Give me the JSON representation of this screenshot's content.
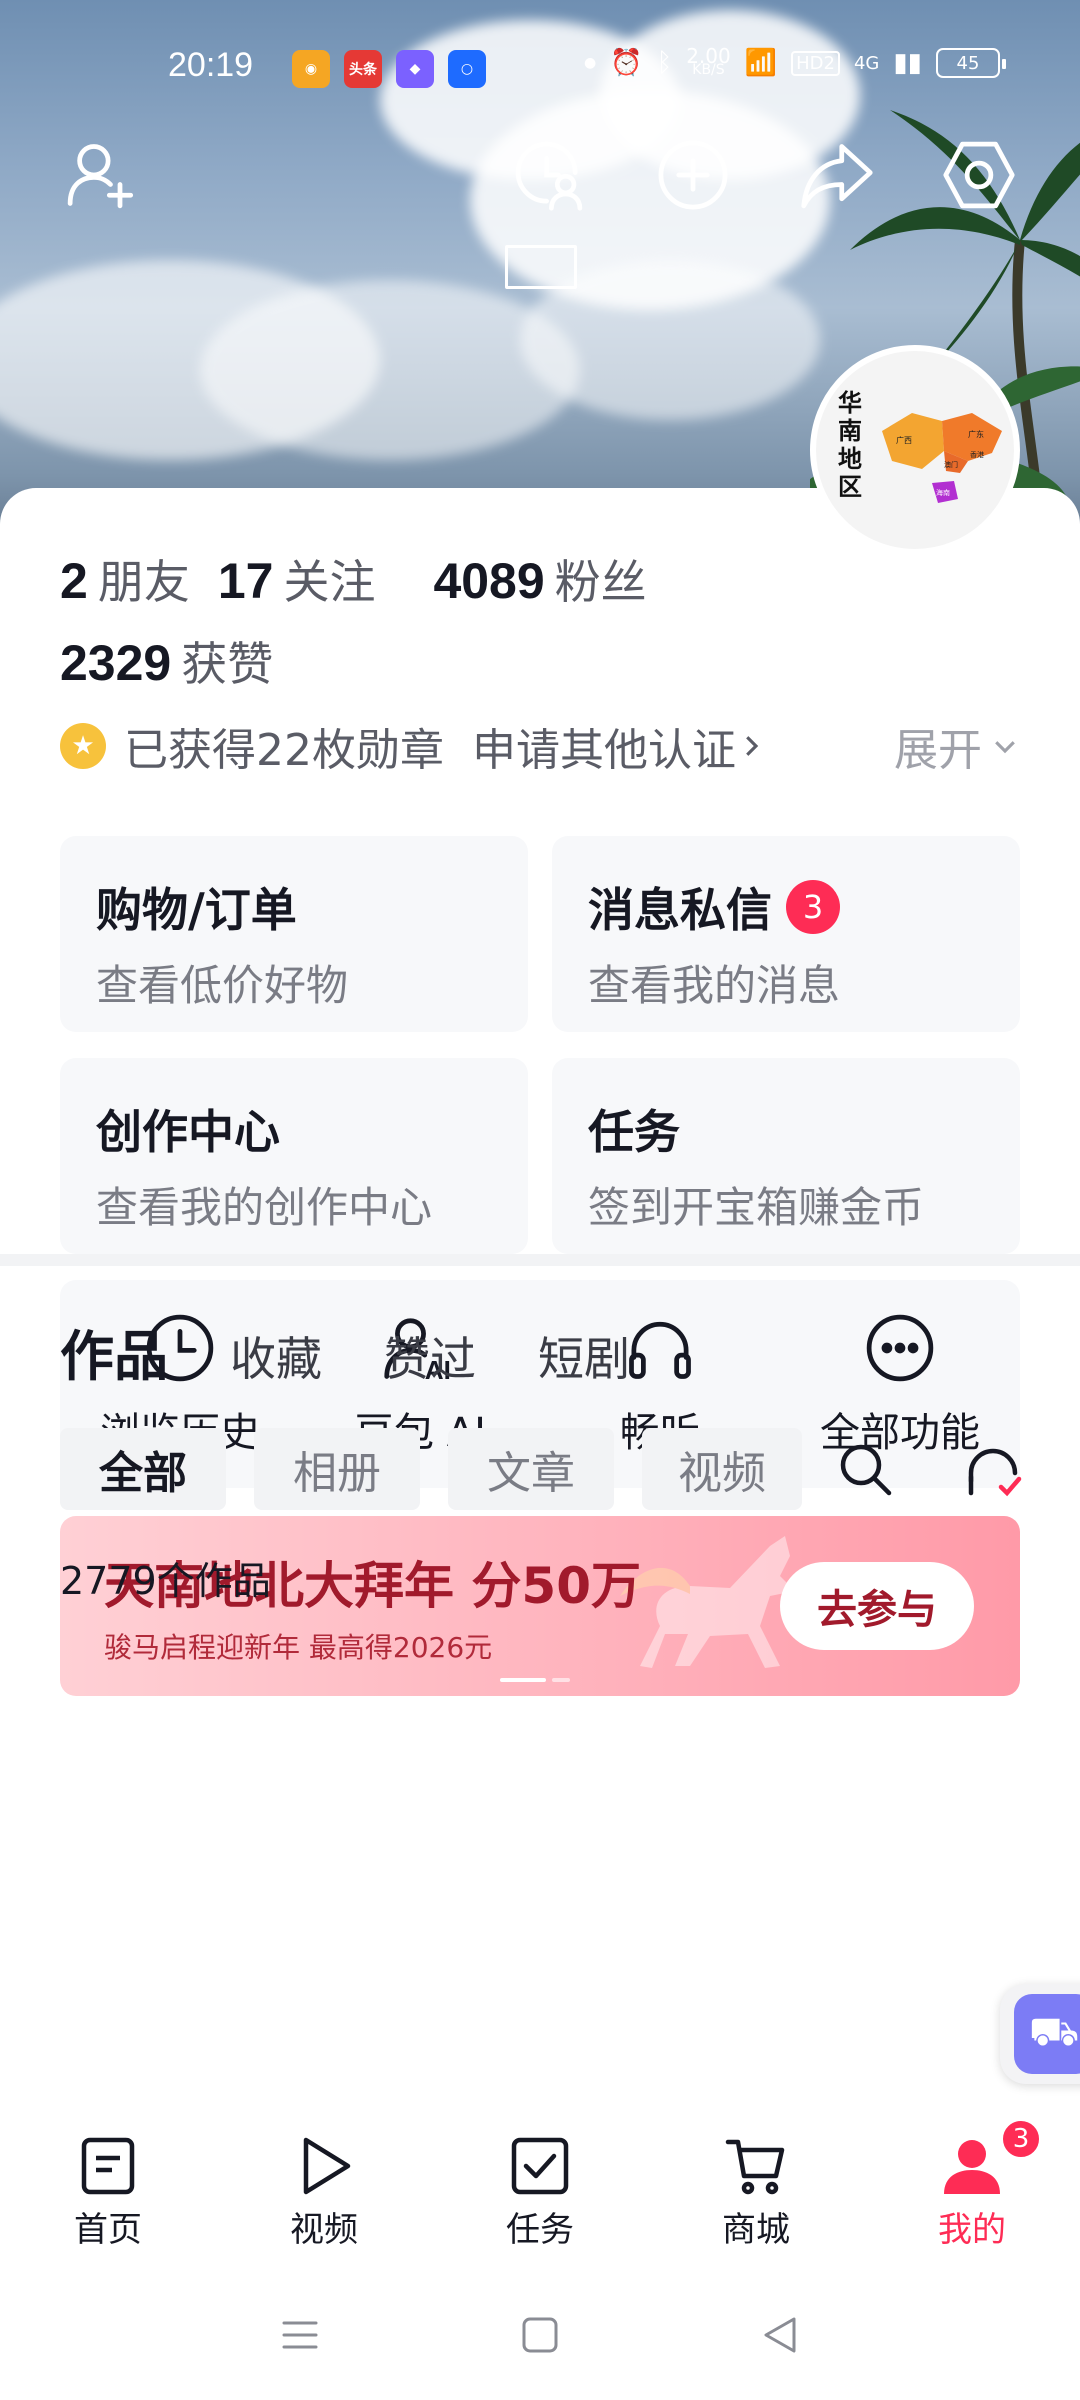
{
  "status_bar": {
    "time": "20:19",
    "apps": [
      {
        "icon": "weibo-app-icon",
        "label": "",
        "color": "#f5a623"
      },
      {
        "icon": "toutiao-app-icon",
        "label": "头条",
        "color": "#e53935"
      },
      {
        "icon": "shortcut-app-icon",
        "label": "",
        "color": "#7b61ff"
      },
      {
        "icon": "qq-browser-app-icon",
        "label": "",
        "color": "#1e6bff"
      }
    ],
    "net_speed_value": "2.00",
    "net_speed_unit": "KB/S",
    "hd": "HD2",
    "signal": "4G",
    "battery": "45"
  },
  "header_buttons": {
    "add_friend": "add-friend-icon",
    "visitors": "visitor-history-icon",
    "create": "plus-circle-icon",
    "share": "share-icon",
    "settings": "settings-hexagon-icon"
  },
  "avatar": {
    "title": "华南地区",
    "map_labels": [
      "广西",
      "广东",
      "澳门",
      "香港",
      "海南"
    ]
  },
  "stats": {
    "friends_count": "2",
    "friends_label": "朋友",
    "following_count": "17",
    "following_label": "关注",
    "followers_count": "4089",
    "followers_label": "粉丝",
    "likes_count": "2329",
    "likes_label": "获赞"
  },
  "badges": {
    "medals_text": "已获得22枚勋章",
    "apply_text": "申请其他认证",
    "expand_text": "展开"
  },
  "tiles": [
    {
      "title": "购物/订单",
      "subtitle": "查看低价好物",
      "badge": ""
    },
    {
      "title": "消息私信",
      "subtitle": "查看我的消息",
      "badge": "3"
    },
    {
      "title": "创作中心",
      "subtitle": "查看我的创作中心",
      "badge": ""
    },
    {
      "title": "任务",
      "subtitle": "签到开宝箱赚金币",
      "badge": ""
    }
  ],
  "quick_actions": [
    {
      "label": "浏览历史",
      "icon": "clock-icon"
    },
    {
      "label": "豆包 AI",
      "icon": "doubao-ai-icon"
    },
    {
      "label": "畅听",
      "icon": "headphones-icon"
    },
    {
      "label": "全部功能",
      "icon": "more-dots-icon"
    }
  ],
  "banner": {
    "title": "天南地北大拜年 分50万",
    "subtitle": "骏马启程迎新年 最高得2026元",
    "button": "去参与"
  },
  "content_tabs": [
    "作品",
    "收藏",
    "赞过",
    "短剧"
  ],
  "filters": [
    "全部",
    "相册",
    "文章",
    "视频"
  ],
  "works_count": "2779个作品",
  "bottom_nav": [
    {
      "label": "首页",
      "icon": "home-doc-icon"
    },
    {
      "label": "视频",
      "icon": "play-icon"
    },
    {
      "label": "任务",
      "icon": "task-check-icon"
    },
    {
      "label": "商城",
      "icon": "cart-icon"
    },
    {
      "label": "我的",
      "icon": "profile-icon",
      "badge": "3"
    }
  ],
  "colors": {
    "accent": "#fe2c55",
    "banner_text": "#a11a2c",
    "tile_bg": "#f7f8fa"
  }
}
